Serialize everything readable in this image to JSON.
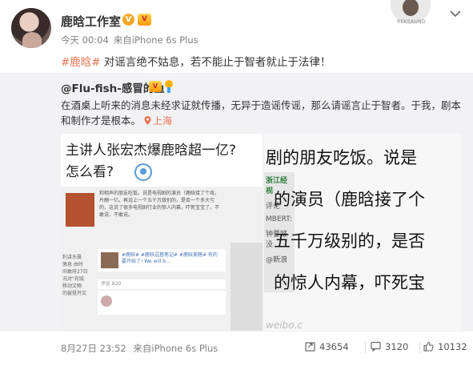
{
  "post": {
    "author_name": "鹿晗工作室",
    "verified_badge": "V",
    "vip_badge": "Vip",
    "time": "今天 00:04",
    "source": "来自iPhone 6s Plus",
    "topic_tag": "#鹿晗#",
    "text": " 对谣言绝不姑息，若不能止于智者就止于法律！"
  },
  "corner": {
    "label": "REKSAUND"
  },
  "repost": {
    "author": "@Flu-fish-感冒的鱼",
    "text": "在酒桌上听来的消息未经求证就传播，无异于造谣传谣，那么请谣言止于智者。于我，剧本和制作才是根本。",
    "location": "上海",
    "image_left": {
      "title_line1": "主讲人张宏杰爆鹿晗超一亿?",
      "title_line2": "怎么看?",
      "snippet": "和相声的朋友吃饭。说是电视剧的演员（鹿晗接了个戏，片酬一亿。再说上一个五千万级别的，是否一个多大亏的，这说了很多电视剧行业的惊人内幕，吓死宝宝了，不敢说，不敢说。",
      "card_text": "#鹿晗# #鹿晗逗基笔记# #鹿晗美瞎# 有的要开始了! We will b...",
      "bar_text": "评论 820",
      "side_text": "利讲东晨\n激息 由时\n间敢府27日\n况对\"宛城\n移动文物\n的被挺开文"
    },
    "image_right": {
      "line1": "剧的朋友吃饭。说是",
      "line2": "的演员（鹿晗接了个",
      "line3": "五千万级别的，是否",
      "line4": "的惊人内幕，吓死宝",
      "strip_items": [
        "浙江经视",
        "评论",
        "MBERT:",
        "钟要啵没",
        "@新浪"
      ],
      "watermark": "weibo.c"
    }
  },
  "footer": {
    "date": "8月27日 23:52",
    "source": "来自iPhone 6s Plus",
    "reposts": "43654",
    "comments": "3120",
    "likes": "10132"
  }
}
